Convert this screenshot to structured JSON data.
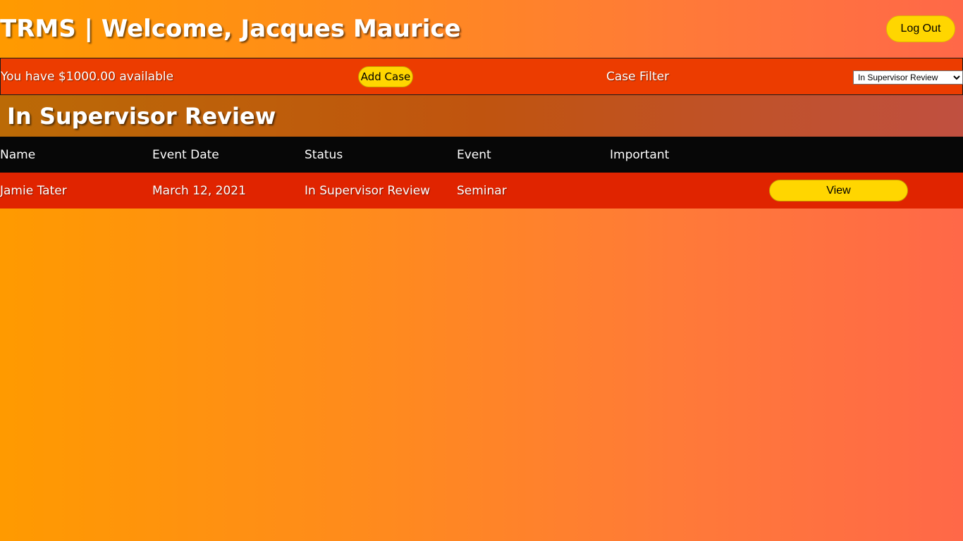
{
  "header": {
    "title": "TRMS | Welcome, Jacques Maurice",
    "logout_label": "Log Out"
  },
  "toolbar": {
    "funds_text": "You have $1000.00 available",
    "add_case_label": "Add Case",
    "filter_label": "Case Filter",
    "filter_selected": "In Supervisor Review"
  },
  "section": {
    "title": "In Supervisor Review"
  },
  "table": {
    "columns": [
      "Name",
      "Event Date",
      "Status",
      "Event",
      "Important"
    ],
    "rows": [
      {
        "name": "Jamie Tater",
        "event_date": "March 12, 2021",
        "status": "In Supervisor Review",
        "event": "Seminar",
        "important": "",
        "action_label": "View"
      }
    ]
  },
  "colors": {
    "accent_button": "#ffd600",
    "toolbar_bg": "#ec3c00",
    "row_bg": "#e02400",
    "header_bg": "#070707"
  }
}
